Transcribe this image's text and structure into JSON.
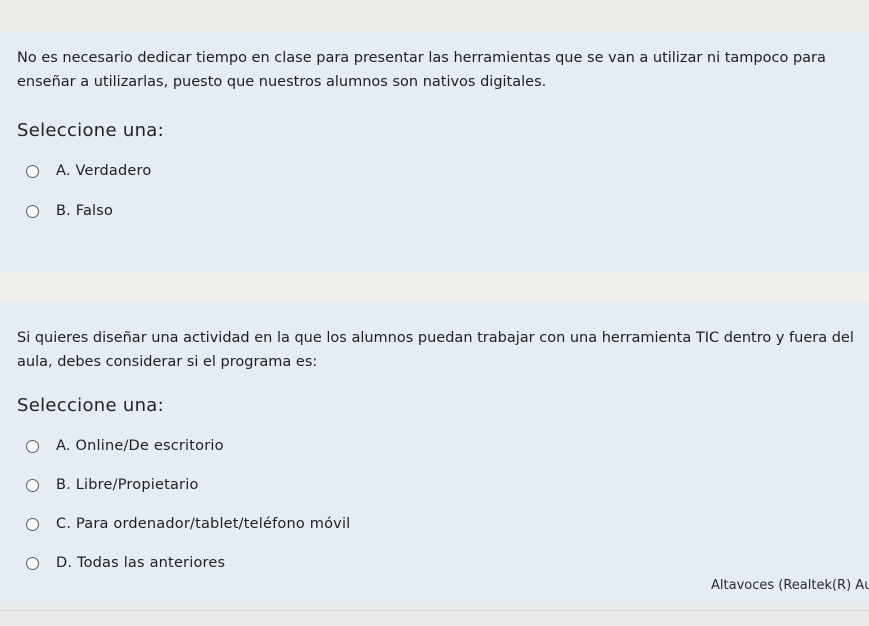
{
  "questions": [
    {
      "text": "No es necesario dedicar tiempo en clase para presentar las herramientas que se van a utilizar ni tampoco para enseñar a utilizarlas, puesto que nuestros alumnos son nativos digitales.",
      "prompt": "Seleccione una:",
      "options": [
        {
          "label": "A. Verdadero"
        },
        {
          "label": "B. Falso"
        }
      ]
    },
    {
      "text": "Si quieres diseñar una actividad en la que los alumnos puedan trabajar con una herramienta TIC dentro y fuera del aula, debes considerar si el programa es:",
      "prompt": "Seleccione una:",
      "options": [
        {
          "label": "A. Online/De escritorio"
        },
        {
          "label": "B. Libre/Propietario"
        },
        {
          "label": "C. Para ordenador/tablet/teléfono móvil"
        },
        {
          "label": "D. Todas las anteriores"
        }
      ]
    }
  ],
  "status": {
    "audio_device": "Altavoces (Realtek(R) Aud"
  }
}
